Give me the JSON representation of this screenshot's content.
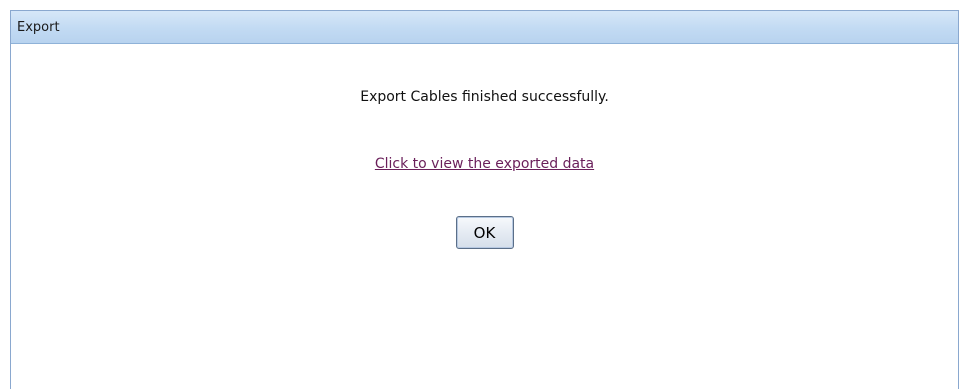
{
  "dialog": {
    "title": "Export",
    "message": "Export Cables finished successfully.",
    "link_text": "Click to view the exported data",
    "ok_label": "OK"
  },
  "colors": {
    "title_bar": "#c2daf3",
    "border": "#8aa8cf",
    "link": "#6a1f5a"
  }
}
